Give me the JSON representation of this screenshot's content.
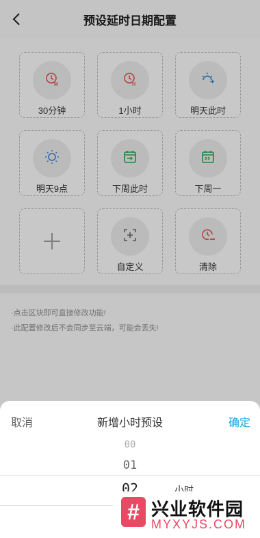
{
  "header": {
    "title": "预设延时日期配置"
  },
  "tiles": [
    {
      "label": "30分钟",
      "icon": "clock-m-icon"
    },
    {
      "label": "1小时",
      "icon": "clock-h-icon"
    },
    {
      "label": "明天此时",
      "icon": "sunrise-icon"
    },
    {
      "label": "明天9点",
      "icon": "sun-icon"
    },
    {
      "label": "下周此时",
      "icon": "calendar-arrow-icon"
    },
    {
      "label": "下周一",
      "icon": "calendar-next-icon"
    },
    {
      "label": "",
      "icon": "plus-icon"
    },
    {
      "label": "自定义",
      "icon": "custom-frame-icon"
    },
    {
      "label": "清除",
      "icon": "clock-minus-icon"
    }
  ],
  "tips": [
    "·点击区块即可直接修改功能!",
    "·此配置修改后不会同步至云端，可能会丢失!"
  ],
  "sheet": {
    "cancel_label": "取消",
    "title": "新增小时预设",
    "confirm_label": "确定",
    "picker_values": [
      "00",
      "01",
      "02"
    ],
    "unit": "小时"
  },
  "colors": {
    "accent": "#1aa9e0",
    "red_icon": "#d9534f",
    "blue_icon": "#3b82d6",
    "green_icon": "#2e9e4f"
  },
  "watermark": {
    "name": "兴业软件园",
    "domain": "MYXYJS.COM"
  }
}
